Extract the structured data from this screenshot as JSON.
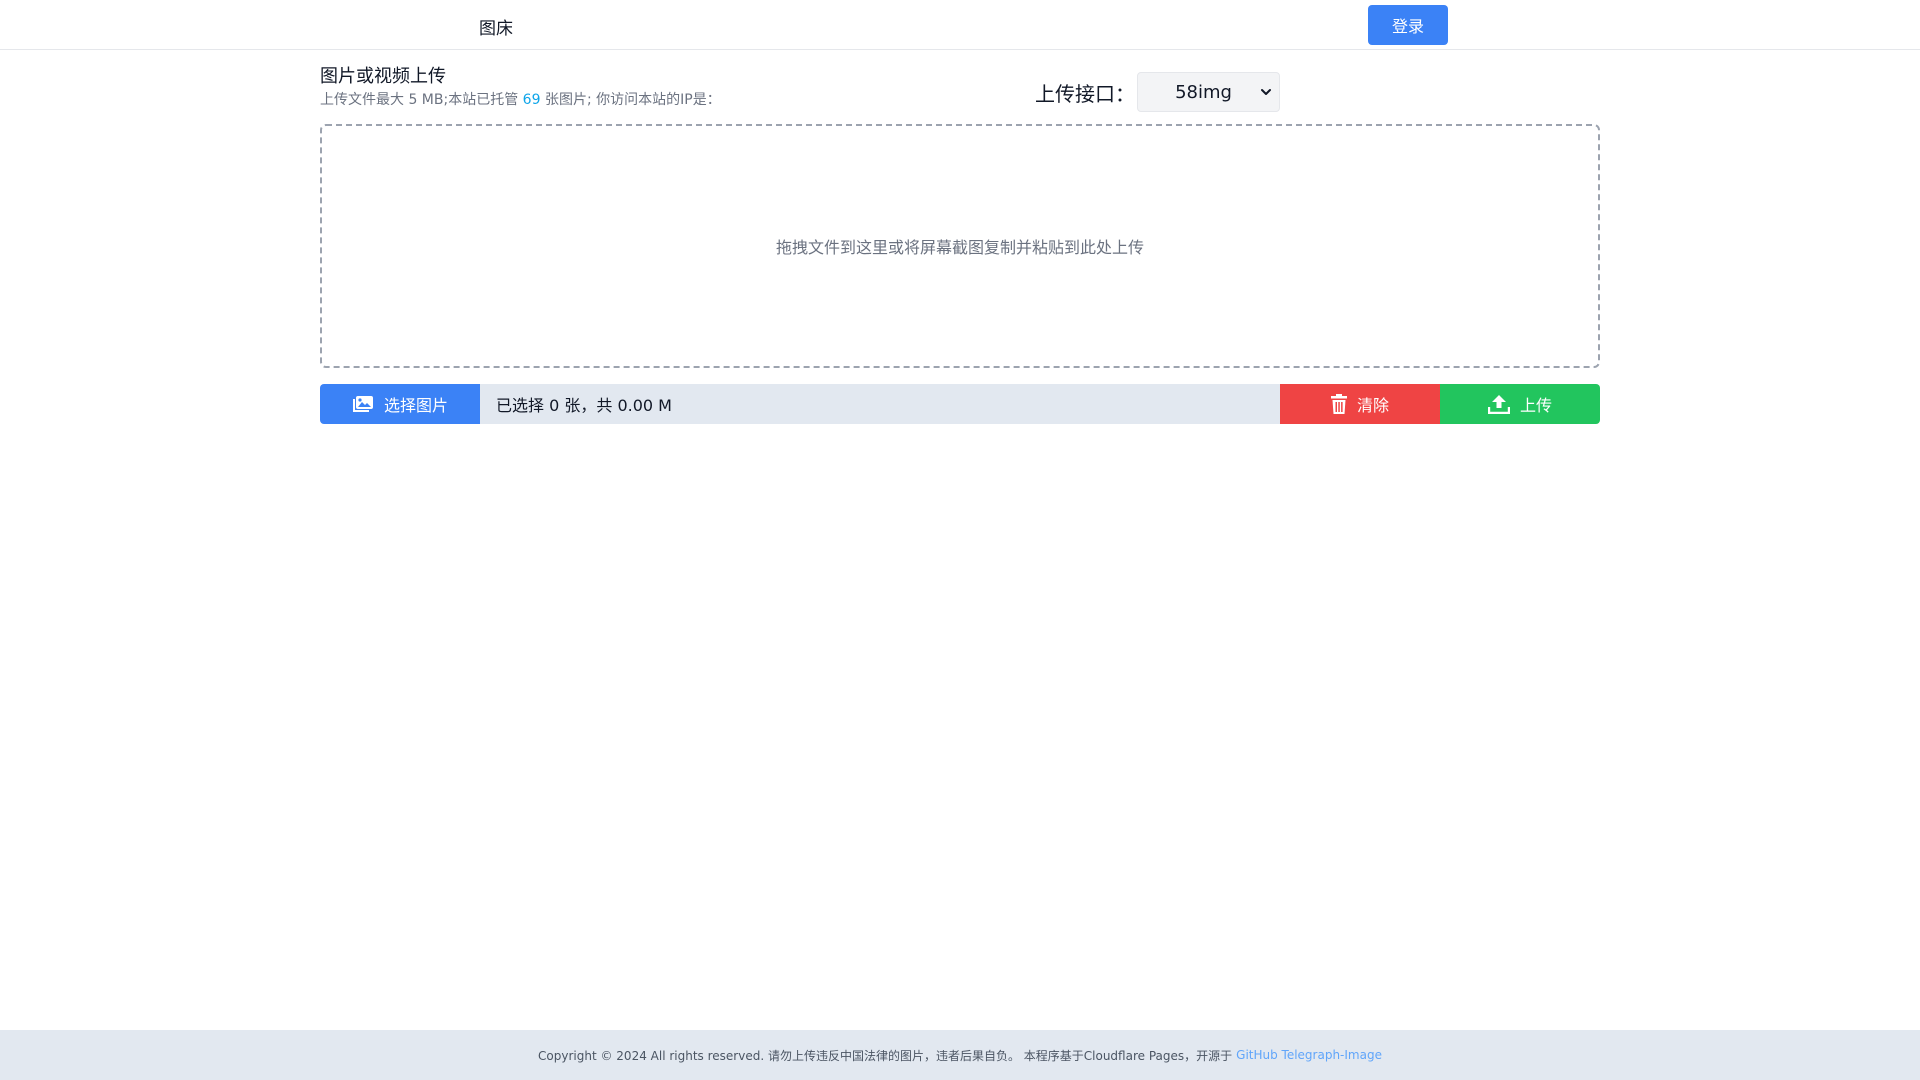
{
  "header": {
    "brand": "图床",
    "login_label": "登录"
  },
  "upload": {
    "title": "图片或视频上传",
    "subtitle_prefix": "上传文件最大 5 MB;本站已托管",
    "hosted_count": "69",
    "subtitle_suffix": "张图片; 你访问本站的IP是：",
    "interface_label": "上传接口：",
    "interface_value": "58img",
    "dropzone_text": "拖拽文件到这里或将屏幕截图复制并粘贴到此处上传"
  },
  "actions": {
    "choose_label": "选择图片",
    "status_text": "已选择 0 张，共 0.00 M",
    "clear_label": "清除",
    "upload_label": "上传"
  },
  "footer": {
    "text": "Copyright © 2024 All rights reserved. 请勿上传违反中国法律的图片，违者后果自负。 本程序基于Cloudflare Pages，开源于",
    "link_text": "GitHub Telegraph-Image"
  },
  "colors": {
    "primary": "#3b82f6",
    "danger": "#ef4444",
    "success": "#22c55e",
    "bar_bg": "#e2e8f0",
    "count_accent": "#0ea5e9"
  },
  "icons": [
    "images-icon",
    "trash-icon",
    "upload-icon",
    "chevron-down-icon"
  ]
}
